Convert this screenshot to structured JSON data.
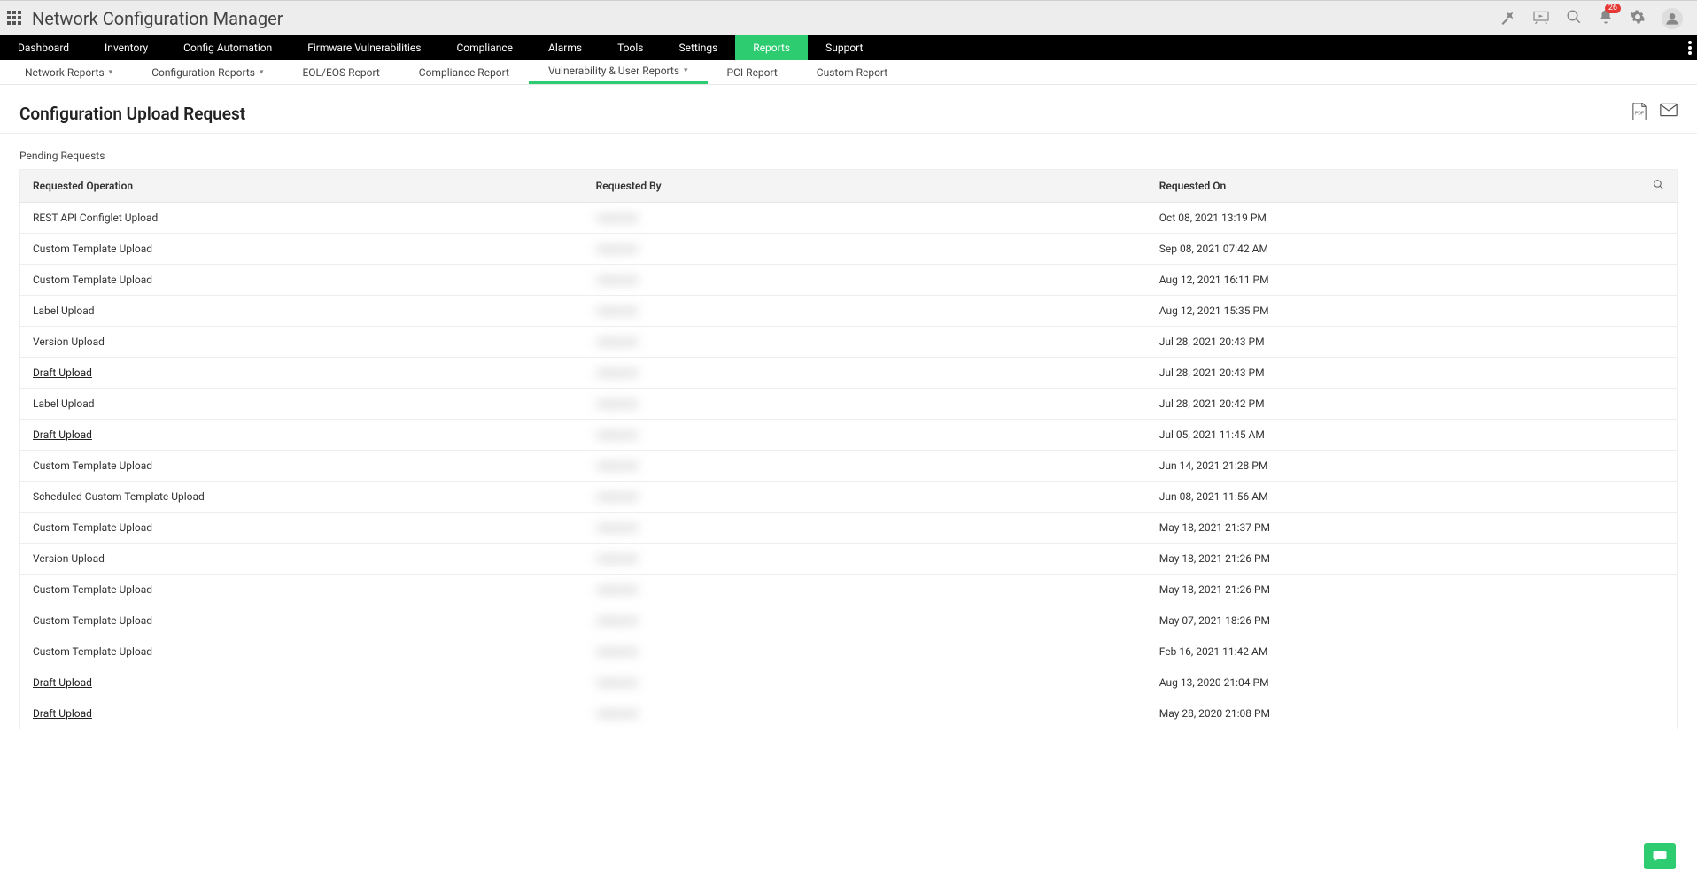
{
  "app_title": "Network Configuration Manager",
  "notification_count": "26",
  "nav": [
    {
      "label": "Dashboard"
    },
    {
      "label": "Inventory"
    },
    {
      "label": "Config Automation"
    },
    {
      "label": "Firmware Vulnerabilities"
    },
    {
      "label": "Compliance"
    },
    {
      "label": "Alarms"
    },
    {
      "label": "Tools"
    },
    {
      "label": "Settings"
    },
    {
      "label": "Reports",
      "active": true
    },
    {
      "label": "Support"
    }
  ],
  "subnav": [
    {
      "label": "Network Reports",
      "dropdown": true
    },
    {
      "label": "Configuration Reports",
      "dropdown": true
    },
    {
      "label": "EOL/EOS Report"
    },
    {
      "label": "Compliance Report"
    },
    {
      "label": "Vulnerability & User Reports",
      "dropdown": true,
      "active": true
    },
    {
      "label": "PCI Report"
    },
    {
      "label": "Custom Report"
    }
  ],
  "page_title": "Configuration Upload Request",
  "section_tab": "Pending Requests",
  "columns": {
    "op": "Requested Operation",
    "by": "Requested By",
    "on": "Requested On"
  },
  "rows": [
    {
      "op": "REST API Configlet Upload",
      "op_link": false,
      "by": "——",
      "on": "Oct 08, 2021 13:19 PM"
    },
    {
      "op": "Custom Template Upload",
      "op_link": false,
      "by": "——",
      "on": "Sep 08, 2021 07:42 AM"
    },
    {
      "op": "Custom Template Upload",
      "op_link": false,
      "by": "——",
      "on": "Aug 12, 2021 16:11 PM"
    },
    {
      "op": "Label Upload",
      "op_link": false,
      "by": "——",
      "on": "Aug 12, 2021 15:35 PM"
    },
    {
      "op": "Version Upload",
      "op_link": false,
      "by": "——",
      "on": "Jul 28, 2021 20:43 PM"
    },
    {
      "op": "Draft Upload",
      "op_link": true,
      "by": "——",
      "on": "Jul 28, 2021 20:43 PM"
    },
    {
      "op": "Label Upload",
      "op_link": false,
      "by": "——",
      "on": "Jul 28, 2021 20:42 PM"
    },
    {
      "op": "Draft Upload",
      "op_link": true,
      "by": "——",
      "on": "Jul 05, 2021 11:45 AM"
    },
    {
      "op": "Custom Template Upload",
      "op_link": false,
      "by": "——",
      "on": "Jun 14, 2021 21:28 PM"
    },
    {
      "op": "Scheduled Custom Template Upload",
      "op_link": false,
      "by": "——",
      "on": "Jun 08, 2021 11:56 AM"
    },
    {
      "op": "Custom Template Upload",
      "op_link": false,
      "by": "——",
      "on": "May 18, 2021 21:37 PM"
    },
    {
      "op": "Version Upload",
      "op_link": false,
      "by": "——",
      "on": "May 18, 2021 21:26 PM"
    },
    {
      "op": "Custom Template Upload",
      "op_link": false,
      "by": "——",
      "on": "May 18, 2021 21:26 PM"
    },
    {
      "op": "Custom Template Upload",
      "op_link": false,
      "by": "——",
      "on": "May 07, 2021 18:26 PM"
    },
    {
      "op": "Custom Template Upload",
      "op_link": false,
      "by": "——",
      "on": "Feb 16, 2021 11:42 AM"
    },
    {
      "op": "Draft Upload",
      "op_link": true,
      "by": "——",
      "on": "Aug 13, 2020 21:04 PM"
    },
    {
      "op": "Draft Upload",
      "op_link": true,
      "by": "——",
      "on": "May 28, 2020 21:08 PM"
    }
  ]
}
